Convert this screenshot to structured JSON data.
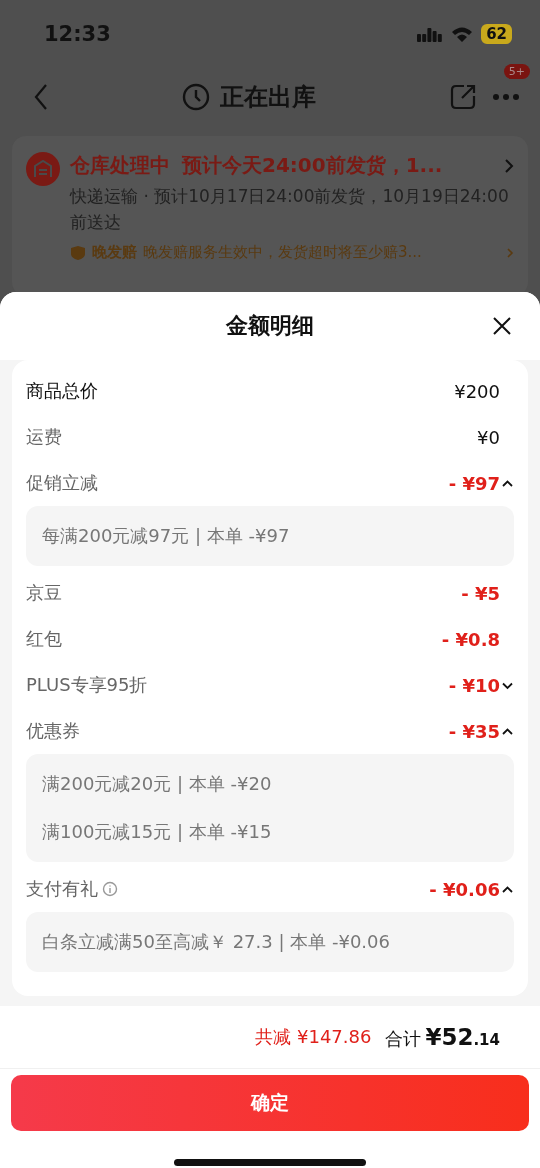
{
  "status_bar": {
    "time": "12:33",
    "battery": "62"
  },
  "nav": {
    "title": "正在出库",
    "badge": "5+"
  },
  "order_status": {
    "title": "仓库处理中",
    "headline": "预计今天24:00前发货，1...",
    "detail": "快递运输 · 预计10月17日24:00前发货，10月19日24:00前送达",
    "guarantee_tag": "晚发赔",
    "guarantee_text": "晚发赔服务生效中，发货超时将至少赔3..."
  },
  "sheet": {
    "title": "金额明细",
    "rows": [
      {
        "kind": "total",
        "label": "商品总价",
        "value": "¥200"
      },
      {
        "kind": "fee",
        "label": "运费",
        "value": "¥0"
      },
      {
        "kind": "discount",
        "label": "促销立减",
        "value": "- ¥97",
        "expanded": true,
        "details": [
          "每满200元减97元 | 本单 -¥97"
        ]
      },
      {
        "kind": "discount",
        "label": "京豆",
        "value": "- ¥5"
      },
      {
        "kind": "discount",
        "label": "红包",
        "value": "- ¥0.8"
      },
      {
        "kind": "discount",
        "label": "PLUS专享95折",
        "value": "- ¥10",
        "expanded": false
      },
      {
        "kind": "discount",
        "label": "优惠券",
        "value": "- ¥35",
        "expanded": true,
        "details": [
          "满200元减20元 | 本单 -¥20",
          "满100元减15元 | 本单 -¥15"
        ]
      },
      {
        "kind": "discount",
        "label": "支付有礼",
        "value": "- ¥0.06",
        "info": true,
        "expanded": true,
        "details": [
          "白条立减满50至高减￥ 27.3 | 本单 -¥0.06"
        ]
      }
    ],
    "saved": "共减 ¥147.86",
    "total_label": "合计",
    "total_amount": "¥52.14",
    "confirm": "确定"
  }
}
